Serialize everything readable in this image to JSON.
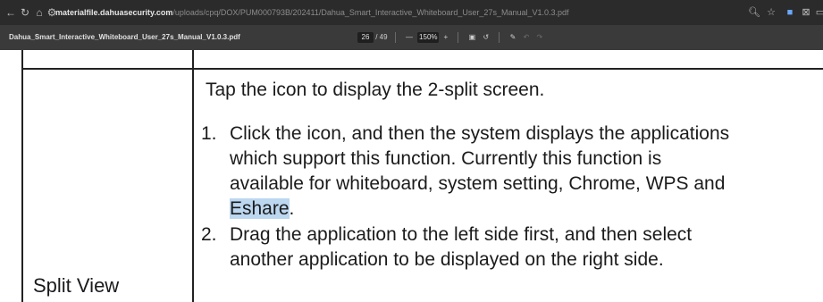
{
  "browser": {
    "address_host": "materialfile.dahuasecurity.com",
    "address_path": "/uploads/cpq/DOX/PUM000793B/202411/Dahua_Smart_Interactive_Whiteboard_User_27s_Manual_V1.0.3.pdf",
    "icons": [
      "back-icon",
      "reload-icon",
      "home-icon",
      "site-info-icon",
      "zoom-icon",
      "bookmark-star-icon",
      "extensions-icon",
      "profile-icon",
      "menu-icon"
    ]
  },
  "pdf_toolbar": {
    "file_name": "Dahua_Smart_Interactive_Whiteboard_User_27s_Manual_V1.0.3.pdf",
    "current_page": "26",
    "total_pages": "/ 49",
    "zoom_out": "—",
    "zoom_value": "150%",
    "zoom_in": "+"
  },
  "document": {
    "row_label": "Split View",
    "intro": "Tap the icon to display the 2-split screen.",
    "steps": [
      {
        "number": "1.",
        "lines": [
          "Click the icon, and then the system displays the applications",
          "which support this function. Currently this function is",
          "available for whiteboard, system setting, Chrome, WPS and"
        ],
        "highlight": "Eshare",
        "after_highlight": "."
      },
      {
        "number": "2.",
        "lines": [
          "Drag the application to the left side first, and then select",
          "another application to be displayed on the right side."
        ]
      }
    ]
  }
}
